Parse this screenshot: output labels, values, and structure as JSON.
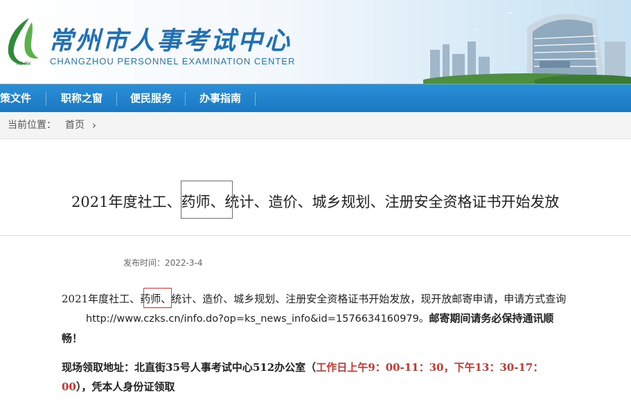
{
  "header": {
    "logo_text": "KS·PX",
    "title_cn": "常州市人事考试中心",
    "title_en": "CHANGZHOU PERSONNEL EXAMINATION CENTER"
  },
  "nav": {
    "items": [
      "策文件",
      "职称之窗",
      "便民服务",
      "办事指南"
    ]
  },
  "breadcrumb": {
    "prefix": "当前位置：",
    "home": "首页",
    "chevron": "›"
  },
  "article": {
    "title_part1": "2021年度社工、",
    "title_highlight": "药师、",
    "title_part2": "统计、造价、城乡规划、注册安全资格证书开始发放",
    "pubdate_label": "发布时间：",
    "pubdate": "2022-3-4",
    "para1_part1": "2021年度社工、",
    "para1_highlight": "药师、",
    "para1_part2": "统计、造价、城乡规划、注册安全资格证书开始发放，现开放邮寄申请，申请方式查询",
    "para1_url": "http://www.czks.cn/info.do?op=ks_news_info&id=1576634160979。",
    "para1_bold1": "邮寄期间请务必保持通讯顺",
    "para1_bold2": "畅！",
    "para2_bold1": "现场领取地址：北直街35号人事考试中心512办公室（",
    "para2_red1": "工作日上午9：00-11：30，下午13：30-17：",
    "para2_red2": "00",
    "para2_bold2": "），凭本人身份证领取"
  },
  "colors": {
    "brand_blue": "#1f70b6",
    "nav_blue": "#1a77c2",
    "highlight_red": "#d4312b"
  }
}
